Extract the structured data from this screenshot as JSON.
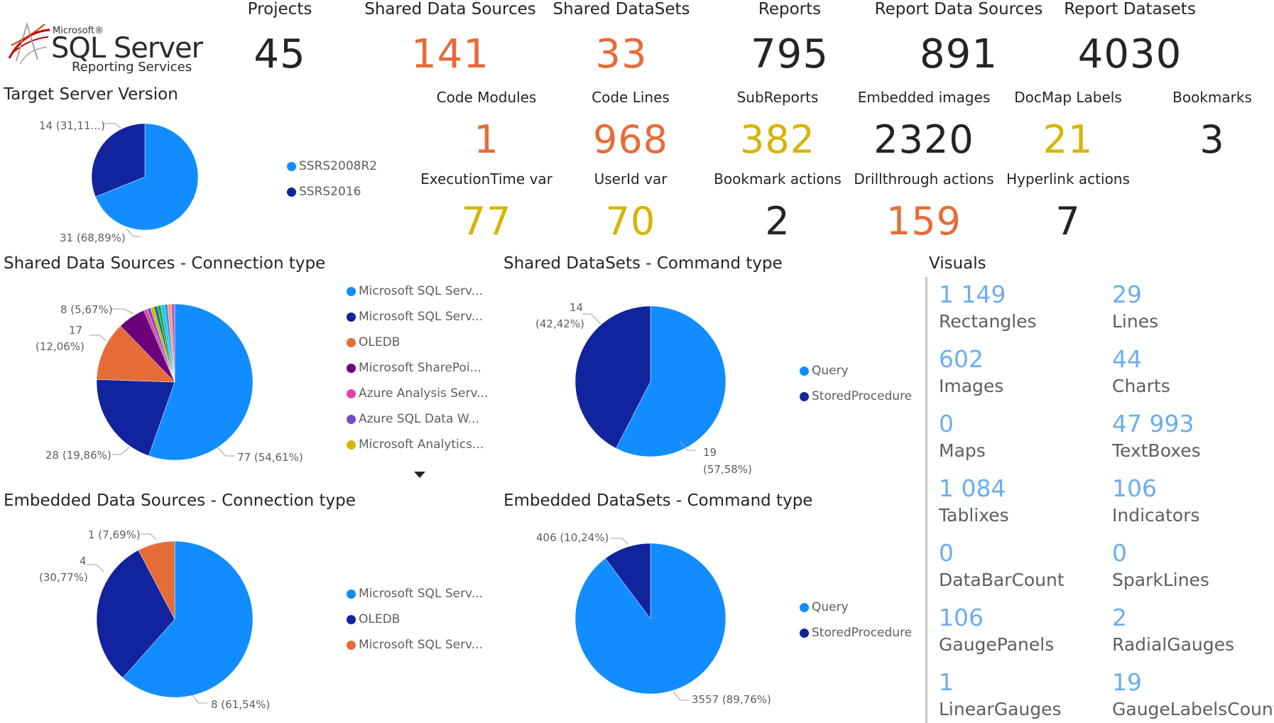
{
  "logo": {
    "microsoft": "Microsoft®",
    "sql_server": "SQL Server",
    "reporting_services": "Reporting Services"
  },
  "kpis": {
    "projects": {
      "label": "Projects",
      "value": "45",
      "color": "#252423"
    },
    "shared_data_sources": {
      "label": "Shared Data Sources",
      "value": "141",
      "color": "#e66c37"
    },
    "shared_datasets": {
      "label": "Shared DataSets",
      "value": "33",
      "color": "#e66c37"
    },
    "reports": {
      "label": "Reports",
      "value": "795",
      "color": "#252423"
    },
    "report_data_sources": {
      "label": "Report Data Sources",
      "value": "891",
      "color": "#252423"
    },
    "report_datasets": {
      "label": "Report Datasets",
      "value": "4030",
      "color": "#252423"
    },
    "code_modules": {
      "label": "Code Modules",
      "value": "1",
      "color": "#e66c37"
    },
    "code_lines": {
      "label": "Code Lines",
      "value": "968",
      "color": "#e66c37"
    },
    "subreports": {
      "label": "SubReports",
      "value": "382",
      "color": "#d9b300"
    },
    "embedded_images": {
      "label": "Embedded images",
      "value": "2320",
      "color": "#252423"
    },
    "docmap_labels": {
      "label": "DocMap Labels",
      "value": "21",
      "color": "#d9b300"
    },
    "bookmarks": {
      "label": "Bookmarks",
      "value": "3",
      "color": "#252423"
    },
    "executiontime_var": {
      "label": "ExecutionTime var",
      "value": "77",
      "color": "#d9b300"
    },
    "userid_var": {
      "label": "UserId var",
      "value": "70",
      "color": "#d9b300"
    },
    "bookmark_actions": {
      "label": "Bookmark actions",
      "value": "2",
      "color": "#252423"
    },
    "drillthrough_actions": {
      "label": "Drillthrough actions",
      "value": "159",
      "color": "#e66c37"
    },
    "hyperlink_actions": {
      "label": "Hyperlink actions",
      "value": "7",
      "color": "#252423"
    }
  },
  "sections": {
    "target_server_version": "Target Server Version",
    "shared_ds_conn": "Shared Data Sources - Connection type",
    "shared_dsets_cmd": "Shared DataSets - Command type",
    "embedded_ds_conn": "Embedded Data Sources - Connection type",
    "embedded_dsets_cmd": "Embedded DataSets - Command type",
    "visuals": "Visuals"
  },
  "legends": {
    "tsv": [
      {
        "label": "SSRS2008R2",
        "color": "#118dff"
      },
      {
        "label": "SSRS2016",
        "color": "#12239e"
      }
    ],
    "shared_ds": [
      {
        "label": "Microsoft SQL Serv...",
        "color": "#118dff"
      },
      {
        "label": "Microsoft SQL Serv...",
        "color": "#12239e"
      },
      {
        "label": "OLEDB",
        "color": "#e66c37"
      },
      {
        "label": "Microsoft SharePoi...",
        "color": "#6b007b"
      },
      {
        "label": "Azure Analysis Serv...",
        "color": "#e044a7"
      },
      {
        "label": "Azure SQL Data W...",
        "color": "#744ec2"
      },
      {
        "label": "Microsoft Analytics...",
        "color": "#d9b300"
      }
    ],
    "shared_dsets": [
      {
        "label": "Query",
        "color": "#118dff"
      },
      {
        "label": "StoredProcedure",
        "color": "#12239e"
      }
    ],
    "embedded_ds": [
      {
        "label": "Microsoft SQL Serv...",
        "color": "#118dff"
      },
      {
        "label": "OLEDB",
        "color": "#12239e"
      },
      {
        "label": "Microsoft SQL Serv...",
        "color": "#e66c37"
      }
    ],
    "embedded_dsets": [
      {
        "label": "Query",
        "color": "#118dff"
      },
      {
        "label": "StoredProcedure",
        "color": "#12239e"
      }
    ]
  },
  "pie_labels": {
    "tsv_a": "14 (31,11...)",
    "tsv_b": "31 (68,89%)",
    "sds_a": "8 (5,67%)",
    "sds_b1": "17",
    "sds_b2": "(12,06%)",
    "sds_c": "28 (19,86%)",
    "sds_d": "77 (54,61%)",
    "sdset_a1": "14",
    "sdset_a2": "(42,42%)",
    "sdset_b1": "19",
    "sdset_b2": "(57,58%)",
    "eds_a": "1 (7,69%)",
    "eds_b1": "4",
    "eds_b2": "(30,77%)",
    "eds_c": "8 (61,54%)",
    "edset_a": "406 (10,24%)",
    "edset_b": "3557 (89,76%)"
  },
  "chart_data": [
    {
      "type": "pie",
      "title": "Target Server Version",
      "categories": [
        "SSRS2008R2",
        "SSRS2016"
      ],
      "values": [
        31,
        14
      ],
      "colors": [
        "#118dff",
        "#12239e"
      ]
    },
    {
      "type": "pie",
      "title": "Shared Data Sources - Connection type",
      "categories": [
        "Microsoft SQL Serv...",
        "Microsoft SQL Serv...",
        "OLEDB",
        "Microsoft SharePoi...",
        "Azure Analysis Serv...",
        "Azure SQL Data W...",
        "Microsoft Analytics..."
      ],
      "values": [
        77,
        28,
        17,
        8,
        1,
        1,
        1
      ],
      "extra_small_slices": [
        1,
        1,
        1,
        1,
        1,
        1
      ],
      "colors": [
        "#118dff",
        "#12239e",
        "#e66c37",
        "#6b007b",
        "#e044a7",
        "#744ec2",
        "#d9b300"
      ],
      "extra_colors": [
        "#197278",
        "#1aab40",
        "#15c6f4",
        "#4092ff",
        "#ffa058",
        "#be5dc9"
      ]
    },
    {
      "type": "pie",
      "title": "Shared DataSets - Command type",
      "categories": [
        "Query",
        "StoredProcedure"
      ],
      "values": [
        19,
        14
      ],
      "colors": [
        "#118dff",
        "#12239e"
      ]
    },
    {
      "type": "pie",
      "title": "Embedded Data Sources - Connection type",
      "categories": [
        "Microsoft SQL Serv...",
        "OLEDB",
        "Microsoft SQL Serv..."
      ],
      "values": [
        8,
        4,
        1
      ],
      "colors": [
        "#118dff",
        "#12239e",
        "#e66c37"
      ]
    },
    {
      "type": "pie",
      "title": "Embedded DataSets - Command type",
      "categories": [
        "Query",
        "StoredProcedure"
      ],
      "values": [
        3557,
        406
      ],
      "colors": [
        "#118dff",
        "#12239e"
      ]
    }
  ],
  "visuals": [
    {
      "value": "1 149",
      "name": "Rectangles"
    },
    {
      "value": "29",
      "name": "Lines"
    },
    {
      "value": "602",
      "name": "Images"
    },
    {
      "value": "44",
      "name": "Charts"
    },
    {
      "value": "0",
      "name": "Maps"
    },
    {
      "value": "47 993",
      "name": "TextBoxes"
    },
    {
      "value": "1 084",
      "name": "Tablixes"
    },
    {
      "value": "106",
      "name": "Indicators"
    },
    {
      "value": "0",
      "name": "DataBarCount"
    },
    {
      "value": "0",
      "name": "SparkLines"
    },
    {
      "value": "106",
      "name": "GaugePanels"
    },
    {
      "value": "2",
      "name": "RadialGauges"
    },
    {
      "value": "1",
      "name": "LinearGauges"
    },
    {
      "value": "19",
      "name": "GaugeLabelsCount"
    }
  ]
}
